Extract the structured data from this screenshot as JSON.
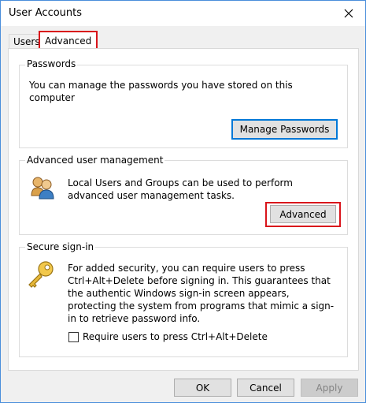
{
  "window": {
    "title": "User Accounts"
  },
  "tabs": [
    {
      "label": "Users"
    },
    {
      "label": "Advanced"
    }
  ],
  "passwords": {
    "group_label": "Passwords",
    "description": "You can manage the passwords you have stored on this computer",
    "button_label": "Manage Passwords"
  },
  "advanced_management": {
    "group_label": "Advanced user management",
    "description": "Local Users and Groups can be used to perform advanced user management tasks.",
    "button_label": "Advanced"
  },
  "secure_signin": {
    "group_label": "Secure sign-in",
    "description": "For added security, you can require users to press Ctrl+Alt+Delete before signing in. This guarantees that the authentic Windows sign-in screen appears, protecting the system from programs that mimic a sign-in to retrieve password info.",
    "checkbox_label": "Require users to press Ctrl+Alt+Delete",
    "checkbox_checked": false
  },
  "footer": {
    "ok_label": "OK",
    "cancel_label": "Cancel",
    "apply_label": "Apply"
  },
  "colors": {
    "highlight": "#d9141b",
    "focus": "#0078d7"
  },
  "icons": {
    "users": "users-group-icon",
    "key": "key-icon",
    "close": "close-icon"
  }
}
